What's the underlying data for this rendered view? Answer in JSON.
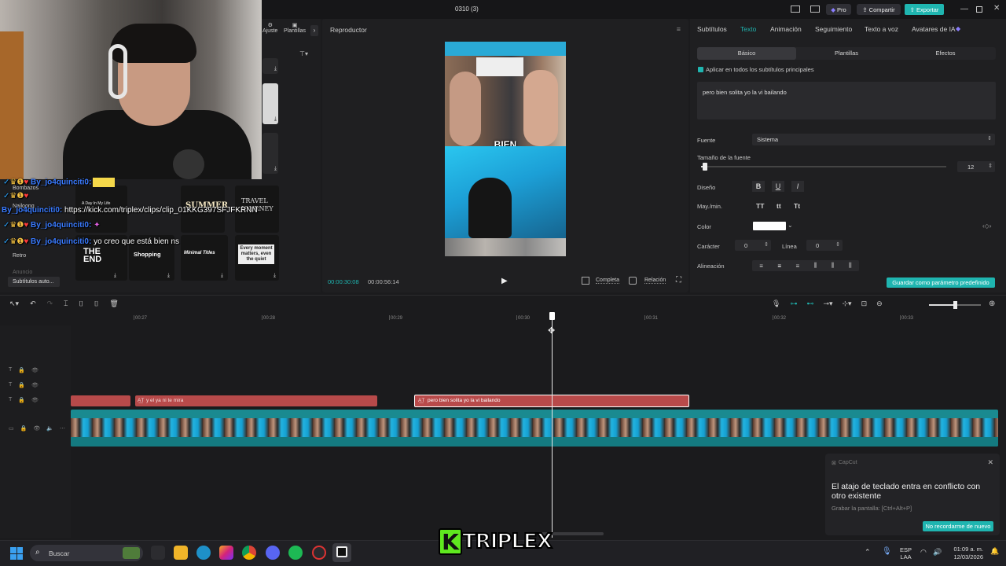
{
  "window": {
    "title": "0310 (3)",
    "pro_label": "Pro",
    "share_label": "Compartir",
    "export_label": "Exportar"
  },
  "left_panel": {
    "tabs": [
      "Ajuste",
      "Plantillas"
    ],
    "sidebar": [
      "Bombazos",
      "Nailoong",
      "Retro",
      "Anuncio",
      "Subtítulos auto..."
    ],
    "templates": [
      "A Day In My Life",
      "SUMMER",
      "TRAVEL JOURNEY",
      "THE END",
      "Shopping",
      "Minimal Titles",
      "Every moment matters, even the quiet"
    ]
  },
  "chat": {
    "messages": [
      {
        "user": "By_jo4quinciti0:",
        "text": ""
      },
      {
        "user": "By_jo4quinciti0:",
        "text": "https://kick.com/triplex/clips/clip_01KKG397SFJFKRNN"
      },
      {
        "user": "By_jo4quinciti0:",
        "text": ""
      },
      {
        "user": "By_jo4quinciti0:",
        "text": "yo creo que está bien ns"
      }
    ]
  },
  "player": {
    "title": "Reproductor",
    "caption_word": "BIEN",
    "current_time": "00:00:30:08",
    "total_time": "00:00:56:14",
    "full_label": "Completa",
    "ratio_label": "Relación"
  },
  "right_panel": {
    "tabs": [
      "Subtítulos",
      "Texto",
      "Animación",
      "Seguimiento",
      "Texto a voz",
      "Avatares de IA"
    ],
    "active_tab": "Texto",
    "subtabs": [
      "Básico",
      "Plantillas",
      "Efectos"
    ],
    "apply_all": "Aplicar en todos los subtítulos principales",
    "text_value": "pero bien solita yo la vi bailando",
    "font_label": "Fuente",
    "font_value": "Sistema",
    "size_label": "Tamaño de la fuente",
    "size_value": "12",
    "design_label": "Diseño",
    "case_label": "May./min.",
    "case_options": [
      "TT",
      "tt",
      "Tt"
    ],
    "color_label": "Color",
    "color_value": "#ffffff",
    "char_label": "Carácter",
    "char_value": "0",
    "line_label": "Línea",
    "line_value": "0",
    "align_label": "Alineación",
    "save_button": "Guardar como parámetro predefinido"
  },
  "timeline": {
    "ticks": [
      "00:27",
      "00:28",
      "00:29",
      "00:30",
      "00:31",
      "00:32",
      "00:33"
    ],
    "clips": [
      {
        "label": ""
      },
      {
        "label": "y el ya ni te mira"
      },
      {
        "label": "pero bien solita yo la vi bailando"
      }
    ]
  },
  "notification": {
    "app": "CapCut",
    "title": "El atajo de teclado entra en conflicto con otro existente",
    "detail": "Grabar la pantalla: [Ctrl+Alt+P]",
    "button": "No recordarme de nuevo"
  },
  "watermark": "KTRIPLEX",
  "taskbar": {
    "search_placeholder": "Buscar",
    "lang_top": "ESP",
    "lang_bottom": "LAA",
    "time": "01:09 a. m.",
    "date": "12/03/2026"
  },
  "colors": {
    "accent": "#1fb5b0",
    "clip_red": "#b84a4a",
    "video_track": "#20a7b5"
  }
}
